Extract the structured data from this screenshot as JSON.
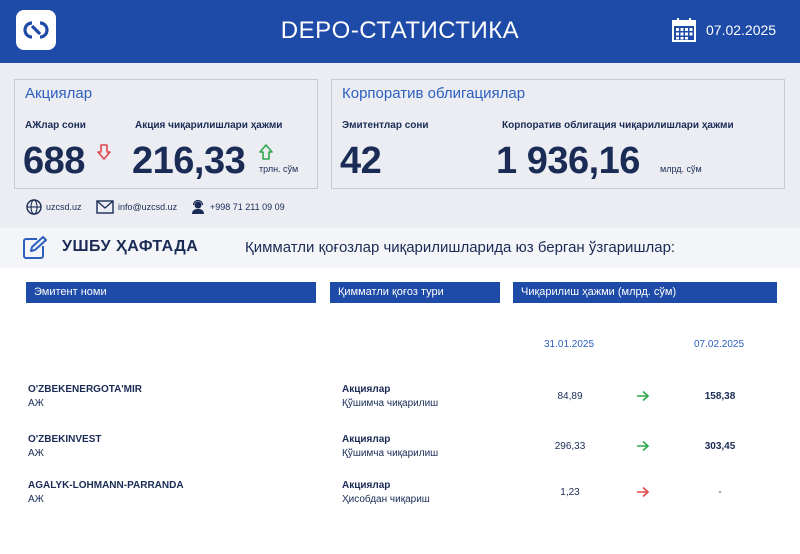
{
  "header": {
    "title": "DEPO-СТАТИСТИКА",
    "date": "07.02.2025",
    "logo_icon": "uzcsd-logo",
    "calendar_icon": "calendar-icon",
    "background": "#1e4aa8"
  },
  "shares": {
    "title": "Акциялар",
    "jsc_count_label": "АЖлар сони",
    "jsc_count": "688",
    "jsc_count_trend": "down",
    "volume_label": "Акция чиқарилишлари ҳажми",
    "volume": "216,33",
    "volume_trend": "up",
    "volume_unit": "трлн. сўм"
  },
  "bonds": {
    "title": "Корпоратив облигациялар",
    "issuers_label": "Эмитентлар сони",
    "issuers": "42",
    "volume_label": "Корпоратив облигация чиқарилишлари ҳажми",
    "volume": "1 936,16",
    "volume_unit": "млрд. сўм"
  },
  "contacts": {
    "website": "uzcsd.uz",
    "email": "info@uzcsd.uz",
    "phone": "+998 71 211 09 09"
  },
  "week": {
    "label": "УШБУ ҲАФТАДА",
    "subtitle": "Қимматли қоғозлар чиқарилишларида юз берган ўзгаришлар:"
  },
  "table": {
    "headers": [
      "Эмитент номи",
      "Қимматли қоғоз тури",
      "Чиқарилиш ҳажми (млрд. сўм)"
    ],
    "date_old": "31.01.2025",
    "date_new": "07.02.2025",
    "rows": [
      {
        "name": "O'ZBEKENERGOTA'MIR",
        "type": "АЖ",
        "security": "Акциялар",
        "action": "Қўшимча чиқарилиш",
        "old": "84,89",
        "new": "158,38",
        "arrow": "green"
      },
      {
        "name": "O'ZBEKINVEST",
        "type": "АЖ",
        "security": "Акциялар",
        "action": "Қўшимча чиқарилиш",
        "old": "296,33",
        "new": "303,45",
        "arrow": "green"
      },
      {
        "name": "AGALYK-LOHMANN-PARRANDA",
        "type": "АЖ",
        "security": "Акциялар",
        "action": "Ҳисобдан чиқариш",
        "old": "1,23",
        "new": "-",
        "arrow": "red"
      }
    ]
  },
  "colors": {
    "brand_blue": "#1e4aa8",
    "accent_blue": "#2d5fbf",
    "up_green": "#2ea84a",
    "down_red": "#e0484b"
  }
}
